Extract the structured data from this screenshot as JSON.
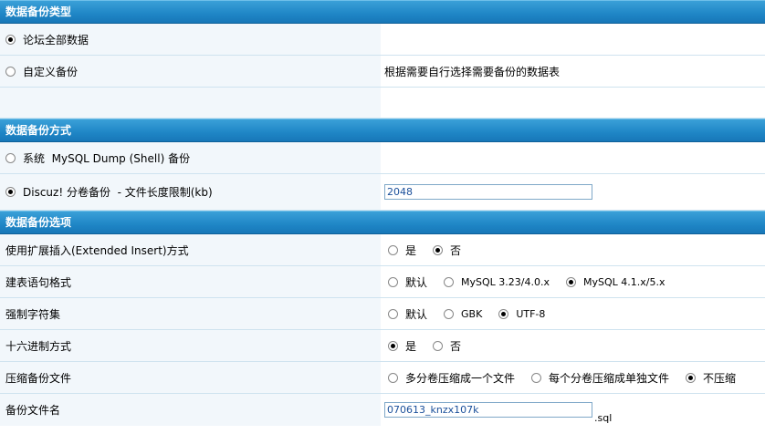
{
  "sec1": {
    "title": "数据备份类型",
    "opt_all": "论坛全部数据",
    "opt_custom": "自定义备份",
    "custom_desc": "根据需要自行选择需要备份的数据表"
  },
  "sec2": {
    "title": "数据备份方式",
    "opt_shell": "系统  MySQL Dump (Shell) 备份",
    "opt_discuz": "Discuz! 分卷备份  - 文件长度限制(kb)",
    "size_value": "2048"
  },
  "sec3": {
    "title": "数据备份选项",
    "extended_label": "使用扩展插入(Extended Insert)方式",
    "yes": "是",
    "no": "否",
    "sqlformat_label": "建表语句格式",
    "default": "默认",
    "mysql323": "MySQL 3.23/4.0.x",
    "mysql41": "MySQL 4.1.x/5.x",
    "charset_label": "强制字符集",
    "gbk": "GBK",
    "utf8": "UTF-8",
    "hex_label": "十六进制方式",
    "compress_label": "压缩备份文件",
    "compress_multi": "多分卷压缩成一个文件",
    "compress_single": "每个分卷压缩成单独文件",
    "compress_none": "不压缩",
    "filename_label": "备份文件名",
    "filename_value": "070613_knzx107k",
    "filename_suffix": ".sql"
  }
}
